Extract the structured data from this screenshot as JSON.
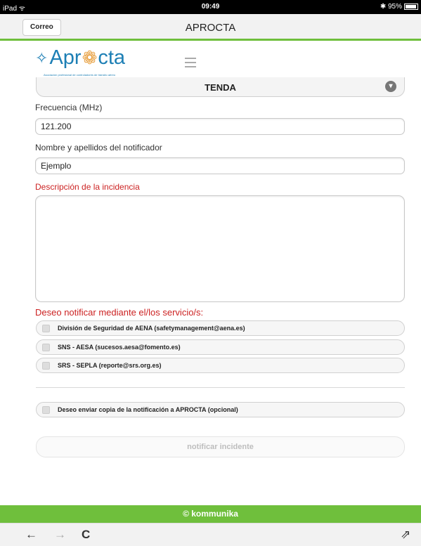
{
  "status": {
    "device": "iPad ᯤ",
    "time": "09:49",
    "battery_text": "✱ 95%"
  },
  "nav": {
    "back_label": "Correo",
    "title": "APROCTA"
  },
  "logo": {
    "text_a": "Apr",
    "text_b": "cta",
    "subtitle": "Asociación profesional de controladores de tránsito aéreo"
  },
  "form": {
    "select_value": "TENDA",
    "frequency_label": "Frecuencia (MHz)",
    "frequency_value": "121.200",
    "name_label": "Nombre y apellidos del notificador",
    "name_value": "Ejemplo",
    "description_label": "Descripción de la incidencia",
    "description_value": "",
    "services_title": "Deseo notificar mediante el/los servicio/s:",
    "services": [
      "División de Seguridad de AENA (safetymanagement@aena.es)",
      "SNS - AESA (sucesos.aesa@fomento.es)",
      "SRS - SEPLA (reporte@srs.org.es)"
    ],
    "copy_label": "Deseo enviar copia de la notificación a APROCTA (opcional)",
    "submit_label": "notificar incidente"
  },
  "footer": {
    "text": "© kommunika"
  },
  "toolbar": {
    "back_icon": "←",
    "forward_icon": "→",
    "reload_icon": "C",
    "share_icon": "⇗"
  },
  "colors": {
    "accent": "#6fbf3c",
    "label_red": "#cc2222",
    "logo_blue": "#1d7fb5"
  }
}
